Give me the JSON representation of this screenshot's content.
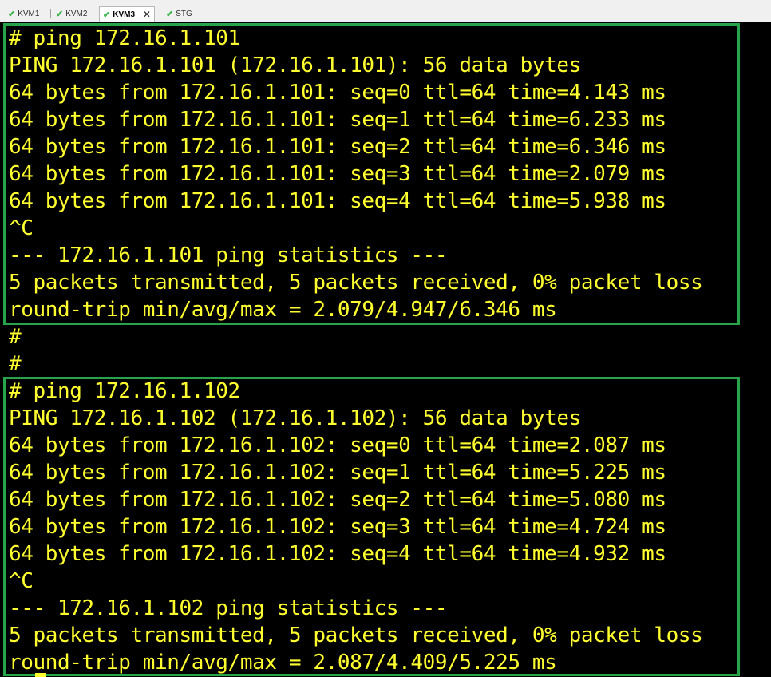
{
  "tabs": [
    {
      "label": "KVM1",
      "active": false
    },
    {
      "label": "KVM2",
      "active": false
    },
    {
      "label": "KVM3",
      "active": true,
      "close_icon": "close-icon"
    },
    {
      "label": "STG",
      "active": false
    }
  ],
  "colors": {
    "terminal_bg": "#000000",
    "terminal_text": "#ffff2f",
    "highlight_box": "#27a34a",
    "tab_check": "#3bb34a"
  },
  "terminal": {
    "lines": [
      "# ping 172.16.1.101",
      "PING 172.16.1.101 (172.16.1.101): 56 data bytes",
      "64 bytes from 172.16.1.101: seq=0 ttl=64 time=4.143 ms",
      "64 bytes from 172.16.1.101: seq=1 ttl=64 time=6.233 ms",
      "64 bytes from 172.16.1.101: seq=2 ttl=64 time=6.346 ms",
      "64 bytes from 172.16.1.101: seq=3 ttl=64 time=2.079 ms",
      "64 bytes from 172.16.1.101: seq=4 ttl=64 time=5.938 ms",
      "^C",
      "--- 172.16.1.101 ping statistics ---",
      "5 packets transmitted, 5 packets received, 0% packet loss",
      "round-trip min/avg/max = 2.079/4.947/6.346 ms",
      "#",
      "#",
      "# ping 172.16.1.102",
      "PING 172.16.1.102 (172.16.1.102): 56 data bytes",
      "64 bytes from 172.16.1.102: seq=0 ttl=64 time=2.087 ms",
      "64 bytes from 172.16.1.102: seq=1 ttl=64 time=5.225 ms",
      "64 bytes from 172.16.1.102: seq=2 ttl=64 time=5.080 ms",
      "64 bytes from 172.16.1.102: seq=3 ttl=64 time=4.724 ms",
      "64 bytes from 172.16.1.102: seq=4 ttl=64 time=4.932 ms",
      "^C",
      "--- 172.16.1.102 ping statistics ---",
      "5 packets transmitted, 5 packets received, 0% packet loss",
      "round-trip min/avg/max = 2.087/4.409/5.225 ms"
    ]
  }
}
